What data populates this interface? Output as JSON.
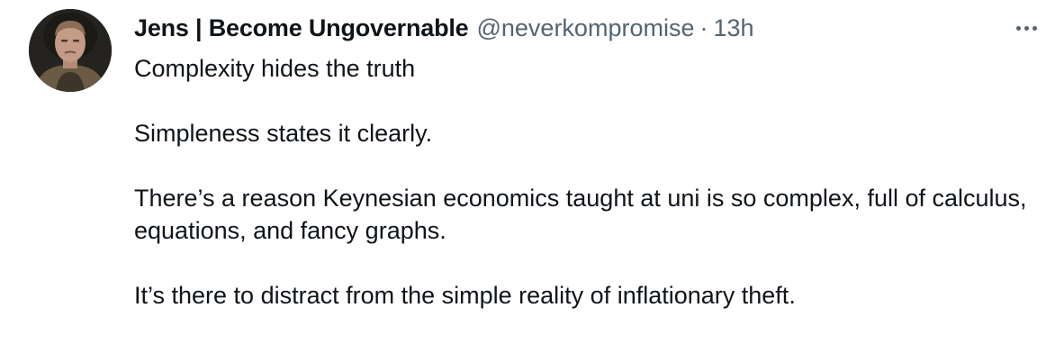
{
  "author": {
    "display_name": "Jens | Become Ungovernable",
    "handle": "@neverkompromise",
    "separator": "·",
    "timestamp": "13h",
    "avatar_icon": "profile-photo"
  },
  "more_icon": "ellipsis-icon",
  "tweet": {
    "paragraphs": [
      "Complexity hides the truth",
      "Simpleness states it clearly.",
      "There’s a reason Keynesian economics taught at uni is so complex, full of calculus, equations, and fancy graphs.",
      "It’s there to distract from the simple reality of inflationary theft."
    ]
  },
  "colors": {
    "text_primary": "#0f1419",
    "text_secondary": "#536471",
    "background": "#ffffff"
  }
}
